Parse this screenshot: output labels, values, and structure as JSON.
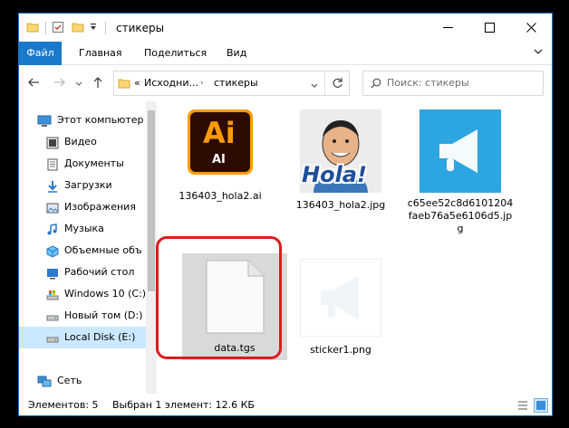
{
  "window": {
    "title": "стикеры"
  },
  "ribbon": {
    "tabs": [
      "Файл",
      "Главная",
      "Поделиться",
      "Вид"
    ]
  },
  "nav": {
    "address": {
      "prefix": "«",
      "segments": [
        "Исходни...",
        "стикеры"
      ]
    },
    "search_placeholder": "Поиск: стикеры"
  },
  "sidebar": {
    "items": [
      {
        "label": "Этот компьютер",
        "icon": "computer-icon"
      },
      {
        "label": "Видео",
        "icon": "video-folder-icon"
      },
      {
        "label": "Документы",
        "icon": "documents-folder-icon"
      },
      {
        "label": "Загрузки",
        "icon": "downloads-icon"
      },
      {
        "label": "Изображения",
        "icon": "pictures-folder-icon"
      },
      {
        "label": "Музыка",
        "icon": "music-icon"
      },
      {
        "label": "Объемные объ",
        "icon": "3d-objects-icon"
      },
      {
        "label": "Рабочий стол",
        "icon": "desktop-icon"
      },
      {
        "label": "Windows 10 (C:)",
        "icon": "drive-c-icon"
      },
      {
        "label": "Новый том (D:)",
        "icon": "drive-d-icon"
      },
      {
        "label": "Local Disk (E:)",
        "icon": "drive-e-icon"
      },
      {
        "label": "Сеть",
        "icon": "network-icon"
      }
    ]
  },
  "files": [
    {
      "name": "136403_hola2.ai",
      "thumb_text_big": "Ai",
      "thumb_text_small": "AI",
      "type": "ai"
    },
    {
      "name": "136403_hola2.jpg",
      "thumb_text": "Hola!",
      "type": "jpg"
    },
    {
      "name": "c65ee52c8d6101204faeb76a5e6106d5.jpg",
      "type": "tg"
    },
    {
      "name": "data.tgs",
      "type": "generic",
      "selected": true
    },
    {
      "name": "sticker1.png",
      "type": "png"
    }
  ],
  "status": {
    "count": "Элементов: 5",
    "selection": "Выбран 1 элемент: 12.6 КБ"
  },
  "colors": {
    "accent": "#1979ca",
    "highlight_border": "#e01b1b",
    "selected_tile": "#d9d9d9",
    "ai_bg": "#2d0b02",
    "ai_orange": "#ff9a00",
    "tg_blue": "#2ca5e0"
  }
}
